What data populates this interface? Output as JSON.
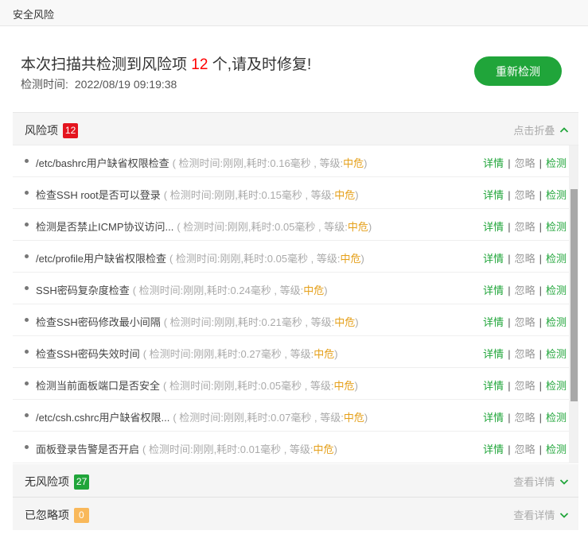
{
  "window": {
    "title": "安全风险"
  },
  "summary": {
    "headline_prefix": "本次扫描共检测到风险项",
    "risk_count": "12",
    "headline_suffix": "个,请及时修复!",
    "time_label": "检测时间:",
    "time_value": "2022/08/19 09:19:38"
  },
  "rescan_button": "重新检测",
  "risk_section": {
    "label": "风险项",
    "count": "12",
    "toggle": "点击折叠"
  },
  "risk_items": [
    {
      "name": "/etc/bashrc用户缺省权限检查",
      "meta": "( 检测时间:刚刚,耗时:0.16毫秒 , 等级:",
      "level": "中危",
      "close": ")"
    },
    {
      "name": "检查SSH root是否可以登录",
      "meta": "( 检测时间:刚刚,耗时:0.15毫秒 , 等级:",
      "level": "中危",
      "close": ")"
    },
    {
      "name": "检测是否禁止ICMP协议访问...",
      "meta": "( 检测时间:刚刚,耗时:0.05毫秒 , 等级:",
      "level": "中危",
      "close": ")"
    },
    {
      "name": "/etc/profile用户缺省权限检查",
      "meta": "( 检测时间:刚刚,耗时:0.05毫秒 , 等级:",
      "level": "中危",
      "close": ")"
    },
    {
      "name": "SSH密码复杂度检查",
      "meta": "( 检测时间:刚刚,耗时:0.24毫秒 , 等级:",
      "level": "中危",
      "close": ")"
    },
    {
      "name": "检查SSH密码修改最小间隔",
      "meta": "( 检测时间:刚刚,耗时:0.21毫秒 , 等级:",
      "level": "中危",
      "close": ")"
    },
    {
      "name": "检查SSH密码失效时间",
      "meta": "( 检测时间:刚刚,耗时:0.27毫秒 , 等级:",
      "level": "中危",
      "close": ")"
    },
    {
      "name": "检测当前面板端口是否安全",
      "meta": "( 检测时间:刚刚,耗时:0.05毫秒 , 等级:",
      "level": "中危",
      "close": ")"
    },
    {
      "name": "/etc/csh.cshrc用户缺省权限...",
      "meta": "( 检测时间:刚刚,耗时:0.07毫秒 , 等级:",
      "level": "中危",
      "close": ")"
    },
    {
      "name": "面板登录告警是否开启",
      "meta": "( 检测时间:刚刚,耗时:0.01毫秒 , 等级:",
      "level": "中危",
      "close": ")"
    }
  ],
  "item_actions": {
    "detail": "详情",
    "ignore": "忽略",
    "recheck": "检测",
    "separator": "|"
  },
  "safe_section": {
    "label": "无风险项",
    "count": "27",
    "toggle": "查看详情"
  },
  "ignored_section": {
    "label": "已忽略项",
    "count": "0",
    "toggle": "查看详情"
  },
  "colors": {
    "accent": "#20a53a",
    "risk": "#e4141e",
    "level": "#e5a01a",
    "ignored_badge": "#f9b85a"
  },
  "icons": {
    "collapse": "chevron-up-icon",
    "expand": "chevron-down-icon"
  }
}
